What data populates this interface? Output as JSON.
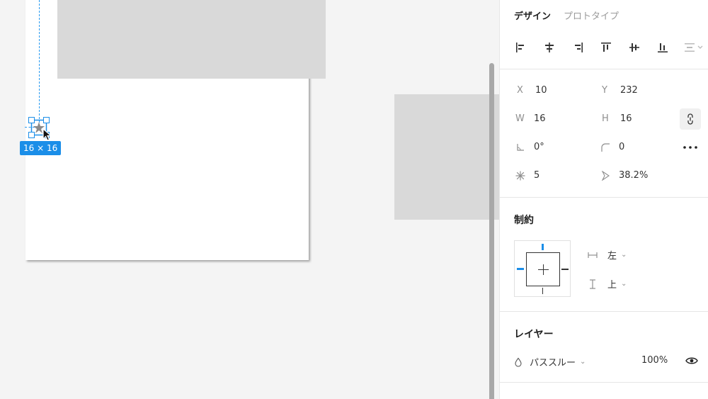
{
  "canvas": {
    "size_badge": "16 × 16"
  },
  "panel": {
    "tabs": [
      {
        "label": "デザイン",
        "active": true
      },
      {
        "label": "プロトタイプ",
        "active": false
      }
    ],
    "align_icons": [
      "align-left-icon",
      "align-horizontal-center-icon",
      "align-right-icon",
      "align-top-icon",
      "align-vertical-center-icon",
      "align-bottom-icon",
      "distribute-icon"
    ],
    "props": {
      "x_label": "X",
      "x_value": "10",
      "y_label": "Y",
      "y_value": "232",
      "w_label": "W",
      "w_value": "16",
      "h_label": "H",
      "h_value": "16",
      "rotation_value": "0°",
      "radius_value": "0",
      "points_value": "5",
      "ratio_value": "38.2%"
    },
    "constraints": {
      "title": "制約",
      "horizontal": "左",
      "vertical": "上"
    },
    "layer": {
      "title": "レイヤー",
      "blend_mode": "パススルー",
      "opacity": "100%"
    }
  },
  "colors": {
    "accent": "#1b8ee8",
    "canvas_bg": "#f4f4f4",
    "shape_fill": "#d9d9d9"
  }
}
